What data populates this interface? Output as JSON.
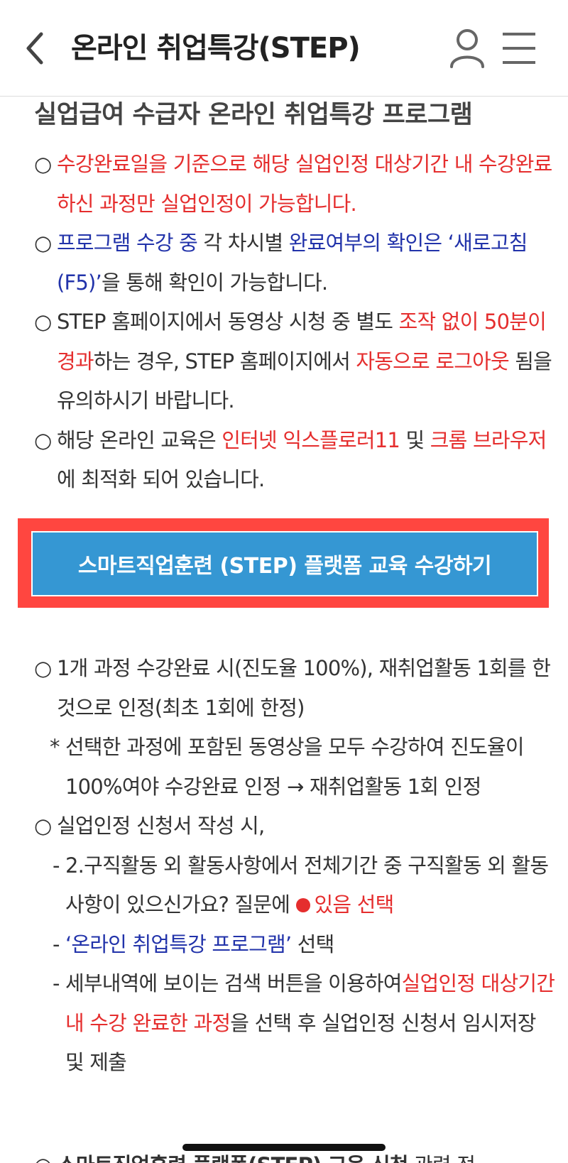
{
  "header": {
    "title": "온라인 취업특강(STEP)",
    "back_icon": "chevron-left-icon",
    "user_icon": "user-icon",
    "menu_icon": "hamburger-menu-icon"
  },
  "section_title": "실업급여 수급자 온라인 취업특강 프로그램",
  "bullet_mark": "○",
  "notices": {
    "n1": {
      "a": "수강완료일을 기준으로 해당 실업인정 대상기간 내 수강완료 하신 과정만 실업인정이 가능합니다."
    },
    "n2": {
      "a": "프로그램 수강 중",
      "b": " 각 차시별 ",
      "c": "완료여부의 확인은 ‘새로고침(F5)’",
      "d": "을 통해 확인이 가능합니다."
    },
    "n3": {
      "a": "STEP 홈페이지에서 동영상 시청 중 별도 ",
      "b": "조작 없이 50분이 경과",
      "c": "하는 경우, STEP 홈페이지에서 ",
      "d": "자동으로 로그아웃",
      "e": " 됨을 유의하시기 바랍니다."
    },
    "n4": {
      "a": "해당 온라인 교육은 ",
      "b": "인터넷 익스플로러11",
      "c": " 및 ",
      "d": "크롬 브라우저",
      "e": "에 최적화 되어 있습니다."
    }
  },
  "cta": {
    "label": "스마트직업훈련 (STEP) 플랫폼 교육 수강하기"
  },
  "details": {
    "d1": "1개 과정 수강완료 시(진도율 100%), 재취업활동 1회를 한 것으로 인정(최초 1회에 한정)",
    "d1_star_mark": "*",
    "d1_star": "선택한 과정에 포함된 동영상을 모두 수강하여 진도율이 100%여야 수강완료 인정 → 재취업활동 1회 인정",
    "d2": "실업인정 신청서 작성 시,",
    "dash": "-",
    "d2_s1a": "2.구직활동 외 활동사항에서 전체기간 중 구직활동 외 활동사항이 있으신가요? 질문에 ",
    "d2_s1b": "있음 선택",
    "d2_s2a": "‘온라인 취업특강 프로그램’",
    "d2_s2b": " 선택",
    "d2_s3a": "세부내역에 보이는 검색 버튼을 이용하여",
    "d2_s3b": "실업인정 대상기간 내 수강 완료한 과정",
    "d2_s3c": "을 선택 후 실업인정 신청서 임시저장 및 제출"
  },
  "partial": {
    "a": "스마트직업훈련 플랫폼(STEP) 교육 신청",
    "b": " 관련 전"
  },
  "colors": {
    "accent_red": "#e52e2e",
    "link_blue": "#2233aa",
    "cta_blue": "#3597d3",
    "cta_frame": "#ff4640"
  }
}
